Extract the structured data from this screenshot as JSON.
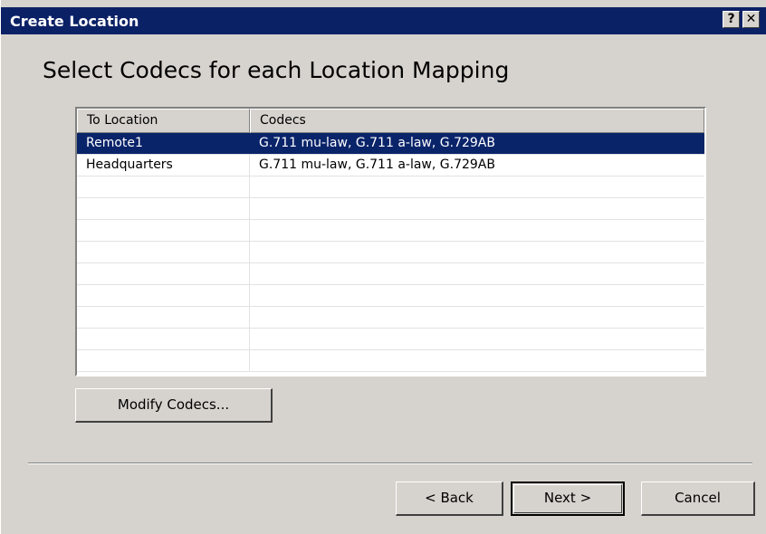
{
  "window": {
    "title": "Create Location",
    "help_glyph": "?",
    "close_glyph": "✕",
    "colors": {
      "titlebar": "#0b2166",
      "face": "#d6d3ce",
      "selection": "#0a246a"
    }
  },
  "page": {
    "heading": "Select Codecs for each Location Mapping"
  },
  "table": {
    "columns": [
      "To Location",
      "Codecs"
    ],
    "rows": [
      {
        "location": "Remote1",
        "codecs": "G.711 mu-law, G.711 a-law, G.729AB",
        "selected": true
      },
      {
        "location": "Headquarters",
        "codecs": "G.711 mu-law, G.711 a-law, G.729AB",
        "selected": false
      }
    ]
  },
  "buttons": {
    "modify": "Modify Codecs...",
    "back": "< Back",
    "next": "Next >",
    "cancel": "Cancel"
  }
}
